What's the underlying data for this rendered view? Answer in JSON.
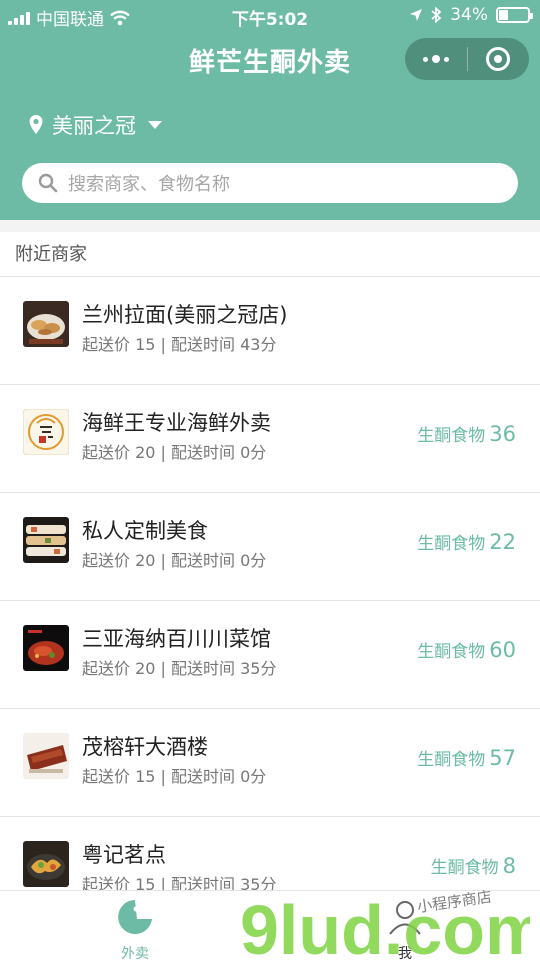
{
  "status_bar": {
    "carrier": "中国联通",
    "time": "下午5:02",
    "battery": "34%"
  },
  "header": {
    "title": "鲜芒生酮外卖",
    "location": "美丽之冠",
    "search_placeholder": "搜索商家、食物名称"
  },
  "section_title": "附近商家",
  "stores": [
    {
      "name": "兰州拉面(美丽之冠店)",
      "meta": "起送价 15 | 配送时间 43分",
      "badge_label": "",
      "badge_count": ""
    },
    {
      "name": "海鲜王专业海鲜外卖",
      "meta": "起送价 20 | 配送时间 0分",
      "badge_label": "生酮食物",
      "badge_count": "36"
    },
    {
      "name": "私人定制美食",
      "meta": "起送价 20 | 配送时间 0分",
      "badge_label": "生酮食物",
      "badge_count": "22"
    },
    {
      "name": "三亚海纳百川川菜馆",
      "meta": "起送价 20 | 配送时间 35分",
      "badge_label": "生酮食物",
      "badge_count": "60"
    },
    {
      "name": "茂榕轩大酒楼",
      "meta": "起送价 15 | 配送时间 0分",
      "badge_label": "生酮食物",
      "badge_count": "57"
    },
    {
      "name": "粤记茗点",
      "meta": "起送价 15 | 配送时间 35分",
      "badge_label": "生酮食物",
      "badge_count": "8"
    }
  ],
  "tabbar": {
    "tabs": [
      {
        "label": "外卖"
      },
      {
        "label": "我"
      }
    ]
  },
  "watermark": {
    "text": "9lud.com",
    "script_text": "小程序商店"
  },
  "colors": {
    "accent": "#6dbba5",
    "capsule": "#4f8f7c"
  }
}
